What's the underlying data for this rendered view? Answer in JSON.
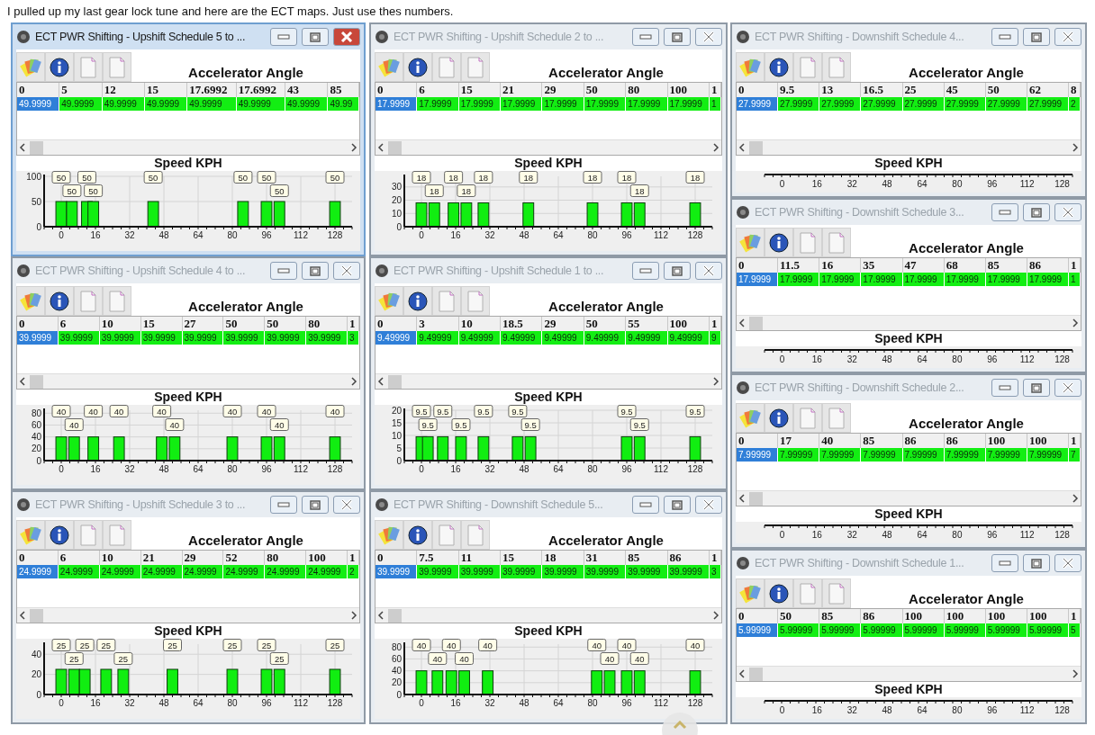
{
  "intro": "I pulled up my last gear lock tune and here are the ECT maps. Just use thes numbers.",
  "left_grid": [
    {
      "title": "ECT PWR Shifting - Upshift Schedule 5 to ...",
      "active": true,
      "axis_label": "Accelerator Angle",
      "columns": [
        "0",
        "5",
        "12",
        "15",
        "17.6992",
        "17.6992",
        "43",
        "85"
      ],
      "values": [
        {
          "text": "49.9999",
          "selected": true
        },
        {
          "text": "49.9999",
          "selected": false
        },
        {
          "text": "49.9999",
          "selected": false
        },
        {
          "text": "49.9999",
          "selected": false
        },
        {
          "text": "49.9999",
          "selected": false
        },
        {
          "text": "49.9999",
          "selected": false
        },
        {
          "text": "49.9999",
          "selected": false
        },
        {
          "text": "49.99",
          "selected": false
        }
      ],
      "chart": {
        "chart_data": {
          "type": "bar",
          "title": "Speed KPH",
          "grid": true,
          "x": [
            0,
            5,
            12,
            15,
            43,
            85,
            96,
            102,
            128
          ],
          "values": [
            50,
            50,
            50,
            50,
            50,
            50,
            50,
            50,
            50
          ],
          "xlim": [
            -8,
            136
          ],
          "ylim": [
            0,
            100
          ],
          "xticks": [
            0,
            16,
            32,
            48,
            64,
            80,
            96,
            112,
            128
          ],
          "yticks": [
            0,
            50,
            100
          ],
          "value_labels": [
            "50",
            "50",
            "50",
            "50",
            "50",
            "50",
            "50",
            "50",
            "50"
          ]
        }
      }
    },
    {
      "title": "ECT PWR Shifting - Upshift Schedule 2 to ...",
      "active": false,
      "axis_label": "Accelerator Angle",
      "columns": [
        "0",
        "6",
        "15",
        "21",
        "29",
        "50",
        "80",
        "100",
        "1"
      ],
      "values": [
        {
          "text": "17.9999",
          "selected": true
        },
        {
          "text": "17.9999",
          "selected": false
        },
        {
          "text": "17.9999",
          "selected": false
        },
        {
          "text": "17.9999",
          "selected": false
        },
        {
          "text": "17.9999",
          "selected": false
        },
        {
          "text": "17.9999",
          "selected": false
        },
        {
          "text": "17.9999",
          "selected": false
        },
        {
          "text": "17.9999",
          "selected": false
        },
        {
          "text": "1",
          "selected": false
        }
      ],
      "chart": {
        "chart_data": {
          "type": "bar",
          "title": "Speed KPH",
          "grid": true,
          "x": [
            0,
            6,
            15,
            21,
            29,
            50,
            80,
            96,
            102,
            128
          ],
          "values": [
            18,
            18,
            18,
            18,
            18,
            18,
            18,
            18,
            18,
            18
          ],
          "xlim": [
            -8,
            136
          ],
          "ylim": [
            0,
            38
          ],
          "xticks": [
            0,
            16,
            32,
            48,
            64,
            80,
            96,
            112,
            128
          ],
          "yticks": [
            0,
            10,
            20,
            30
          ],
          "value_labels": [
            "18",
            "18",
            "18",
            "18",
            "18",
            "18",
            "18",
            "18",
            "18",
            "18"
          ]
        }
      }
    },
    {
      "title": "ECT PWR Shifting - Upshift Schedule 4 to ...",
      "active": false,
      "axis_label": "Accelerator Angle",
      "columns": [
        "0",
        "6",
        "10",
        "15",
        "27",
        "50",
        "50",
        "80",
        "1"
      ],
      "values": [
        {
          "text": "39.9999",
          "selected": true
        },
        {
          "text": "39.9999",
          "selected": false
        },
        {
          "text": "39.9999",
          "selected": false
        },
        {
          "text": "39.9999",
          "selected": false
        },
        {
          "text": "39.9999",
          "selected": false
        },
        {
          "text": "39.9999",
          "selected": false
        },
        {
          "text": "39.9999",
          "selected": false
        },
        {
          "text": "39.9999",
          "selected": false
        },
        {
          "text": "3",
          "selected": false
        }
      ],
      "chart": {
        "chart_data": {
          "type": "bar",
          "title": "Speed KPH",
          "grid": true,
          "x": [
            0,
            6,
            15,
            27,
            47,
            53,
            80,
            96,
            102,
            128
          ],
          "values": [
            40,
            40,
            40,
            40,
            40,
            40,
            40,
            40,
            40,
            40
          ],
          "xlim": [
            -8,
            136
          ],
          "ylim": [
            0,
            85
          ],
          "xticks": [
            0,
            16,
            32,
            48,
            64,
            80,
            96,
            112,
            128
          ],
          "yticks": [
            0,
            20,
            40,
            60,
            80
          ],
          "value_labels": [
            "40",
            "40",
            "40",
            "40",
            "40",
            "40",
            "40",
            "40",
            "40",
            "40"
          ]
        }
      }
    },
    {
      "title": "ECT PWR Shifting - Upshift Schedule 1 to ...",
      "active": false,
      "axis_label": "Accelerator Angle",
      "columns": [
        "0",
        "3",
        "10",
        "18.5",
        "29",
        "50",
        "55",
        "100",
        "1"
      ],
      "values": [
        {
          "text": "9.49999",
          "selected": true
        },
        {
          "text": "9.49999",
          "selected": false
        },
        {
          "text": "9.49999",
          "selected": false
        },
        {
          "text": "9.49999",
          "selected": false
        },
        {
          "text": "9.49999",
          "selected": false
        },
        {
          "text": "9.49999",
          "selected": false
        },
        {
          "text": "9.49999",
          "selected": false
        },
        {
          "text": "9.49999",
          "selected": false
        },
        {
          "text": "9",
          "selected": false
        }
      ],
      "chart": {
        "chart_data": {
          "type": "bar",
          "title": "Speed KPH",
          "grid": true,
          "x": [
            0,
            3,
            10,
            18.5,
            29,
            45,
            51,
            96,
            102,
            128
          ],
          "values": [
            9.5,
            9.5,
            9.5,
            9.5,
            9.5,
            9.5,
            9.5,
            9.5,
            9.5,
            9.5
          ],
          "xlim": [
            -8,
            136
          ],
          "ylim": [
            0,
            20
          ],
          "xticks": [
            0,
            16,
            32,
            48,
            64,
            80,
            96,
            112,
            128
          ],
          "yticks": [
            0,
            5,
            10,
            15,
            20
          ],
          "value_labels": [
            "9.5",
            "9.5",
            "9.5",
            "9.5",
            "9.5",
            "9.5",
            "9.5",
            "9.5",
            "9.5",
            "9.5"
          ]
        }
      }
    },
    {
      "title": "ECT PWR Shifting - Upshift Schedule 3 to ...",
      "active": false,
      "axis_label": "Accelerator Angle",
      "columns": [
        "0",
        "6",
        "10",
        "21",
        "29",
        "52",
        "80",
        "100",
        "1"
      ],
      "values": [
        {
          "text": "24.9999",
          "selected": true
        },
        {
          "text": "24.9999",
          "selected": false
        },
        {
          "text": "24.9999",
          "selected": false
        },
        {
          "text": "24.9999",
          "selected": false
        },
        {
          "text": "24.9999",
          "selected": false
        },
        {
          "text": "24.9999",
          "selected": false
        },
        {
          "text": "24.9999",
          "selected": false
        },
        {
          "text": "24.9999",
          "selected": false
        },
        {
          "text": "2",
          "selected": false
        }
      ],
      "chart": {
        "chart_data": {
          "type": "bar",
          "title": "Speed KPH",
          "grid": true,
          "x": [
            0,
            6,
            11,
            21,
            29,
            52,
            80,
            96,
            102,
            128
          ],
          "values": [
            25,
            25,
            25,
            25,
            25,
            25,
            25,
            25,
            25,
            25
          ],
          "xlim": [
            -8,
            136
          ],
          "ylim": [
            0,
            50
          ],
          "xticks": [
            0,
            16,
            32,
            48,
            64,
            80,
            96,
            112,
            128
          ],
          "yticks": [
            0,
            20,
            40
          ],
          "value_labels": [
            "25",
            "25",
            "25",
            "25",
            "25",
            "25",
            "25",
            "25",
            "25",
            "25"
          ]
        }
      }
    },
    {
      "title": "ECT PWR Shifting - Downshift Schedule 5...",
      "active": false,
      "axis_label": "Accelerator Angle",
      "columns": [
        "0",
        "7.5",
        "11",
        "15",
        "18",
        "31",
        "85",
        "86",
        "1"
      ],
      "values": [
        {
          "text": "39.9999",
          "selected": true
        },
        {
          "text": "39.9999",
          "selected": false
        },
        {
          "text": "39.9999",
          "selected": false
        },
        {
          "text": "39.9999",
          "selected": false
        },
        {
          "text": "39.9999",
          "selected": false
        },
        {
          "text": "39.9999",
          "selected": false
        },
        {
          "text": "39.9999",
          "selected": false
        },
        {
          "text": "39.9999",
          "selected": false
        },
        {
          "text": "3",
          "selected": false
        }
      ],
      "chart": {
        "chart_data": {
          "type": "bar",
          "title": "Speed KPH",
          "grid": true,
          "x": [
            0,
            7.5,
            14,
            20,
            31,
            82,
            88,
            96,
            102,
            128
          ],
          "values": [
            40,
            40,
            40,
            40,
            40,
            40,
            40,
            40,
            40,
            40
          ],
          "xlim": [
            -8,
            136
          ],
          "ylim": [
            0,
            85
          ],
          "xticks": [
            0,
            16,
            32,
            48,
            64,
            80,
            96,
            112,
            128
          ],
          "yticks": [
            0,
            20,
            40,
            60,
            80
          ],
          "value_labels": [
            "40",
            "40",
            "40",
            "40",
            "40",
            "40",
            "40",
            "40",
            "40",
            "40"
          ]
        }
      }
    }
  ],
  "right_column": [
    {
      "title": "ECT PWR Shifting - Downshift Schedule 4...",
      "active": false,
      "axis_label": "Accelerator Angle",
      "columns": [
        "0",
        "9.5",
        "13",
        "16.5",
        "25",
        "45",
        "50",
        "62",
        "8"
      ],
      "values": [
        {
          "text": "27.9999",
          "selected": true
        },
        {
          "text": "27.9999",
          "selected": false
        },
        {
          "text": "27.9999",
          "selected": false
        },
        {
          "text": "27.9999",
          "selected": false
        },
        {
          "text": "27.9999",
          "selected": false
        },
        {
          "text": "27.9999",
          "selected": false
        },
        {
          "text": "27.9999",
          "selected": false
        },
        {
          "text": "27.9999",
          "selected": false
        },
        {
          "text": "2",
          "selected": false
        }
      ],
      "speed_axis": {
        "title": "Speed KPH",
        "labels": [
          "0",
          "16",
          "32",
          "48",
          "64",
          "80",
          "96",
          "112",
          "128"
        ]
      }
    },
    {
      "title": "ECT PWR Shifting - Downshift Schedule 3...",
      "active": false,
      "axis_label": "Accelerator Angle",
      "columns": [
        "0",
        "11.5",
        "16",
        "35",
        "47",
        "68",
        "85",
        "86",
        "1"
      ],
      "values": [
        {
          "text": "17.9999",
          "selected": true
        },
        {
          "text": "17.9999",
          "selected": false
        },
        {
          "text": "17.9999",
          "selected": false
        },
        {
          "text": "17.9999",
          "selected": false
        },
        {
          "text": "17.9999",
          "selected": false
        },
        {
          "text": "17.9999",
          "selected": false
        },
        {
          "text": "17.9999",
          "selected": false
        },
        {
          "text": "17.9999",
          "selected": false
        },
        {
          "text": "1",
          "selected": false
        }
      ],
      "speed_axis": {
        "title": "Speed KPH",
        "labels": [
          "0",
          "16",
          "32",
          "48",
          "64",
          "80",
          "96",
          "112",
          "128"
        ]
      }
    },
    {
      "title": "ECT PWR Shifting - Downshift Schedule 2...",
      "active": false,
      "axis_label": "Accelerator Angle",
      "columns": [
        "0",
        "17",
        "40",
        "85",
        "86",
        "86",
        "100",
        "100",
        "1"
      ],
      "values": [
        {
          "text": "7.99999",
          "selected": true
        },
        {
          "text": "7.99999",
          "selected": false
        },
        {
          "text": "7.99999",
          "selected": false
        },
        {
          "text": "7.99999",
          "selected": false
        },
        {
          "text": "7.99999",
          "selected": false
        },
        {
          "text": "7.99999",
          "selected": false
        },
        {
          "text": "7.99999",
          "selected": false
        },
        {
          "text": "7.99999",
          "selected": false
        },
        {
          "text": "7",
          "selected": false
        }
      ],
      "speed_axis": {
        "title": "Speed KPH",
        "labels": [
          "0",
          "16",
          "32",
          "48",
          "64",
          "80",
          "96",
          "112",
          "128"
        ]
      }
    },
    {
      "title": "ECT PWR Shifting - Downshift Schedule 1...",
      "active": false,
      "axis_label": "Accelerator Angle",
      "columns": [
        "0",
        "50",
        "85",
        "86",
        "100",
        "100",
        "100",
        "100",
        "1"
      ],
      "values": [
        {
          "text": "5.99999",
          "selected": true
        },
        {
          "text": "5.99999",
          "selected": false
        },
        {
          "text": "5.99999",
          "selected": false
        },
        {
          "text": "5.99999",
          "selected": false
        },
        {
          "text": "5.99999",
          "selected": false
        },
        {
          "text": "5.99999",
          "selected": false
        },
        {
          "text": "5.99999",
          "selected": false
        },
        {
          "text": "5.99999",
          "selected": false
        },
        {
          "text": "5",
          "selected": false
        }
      ],
      "speed_axis": {
        "title": "Speed KPH",
        "labels": [
          "0",
          "16",
          "32",
          "48",
          "64",
          "80",
          "96",
          "112",
          "128"
        ]
      }
    }
  ]
}
